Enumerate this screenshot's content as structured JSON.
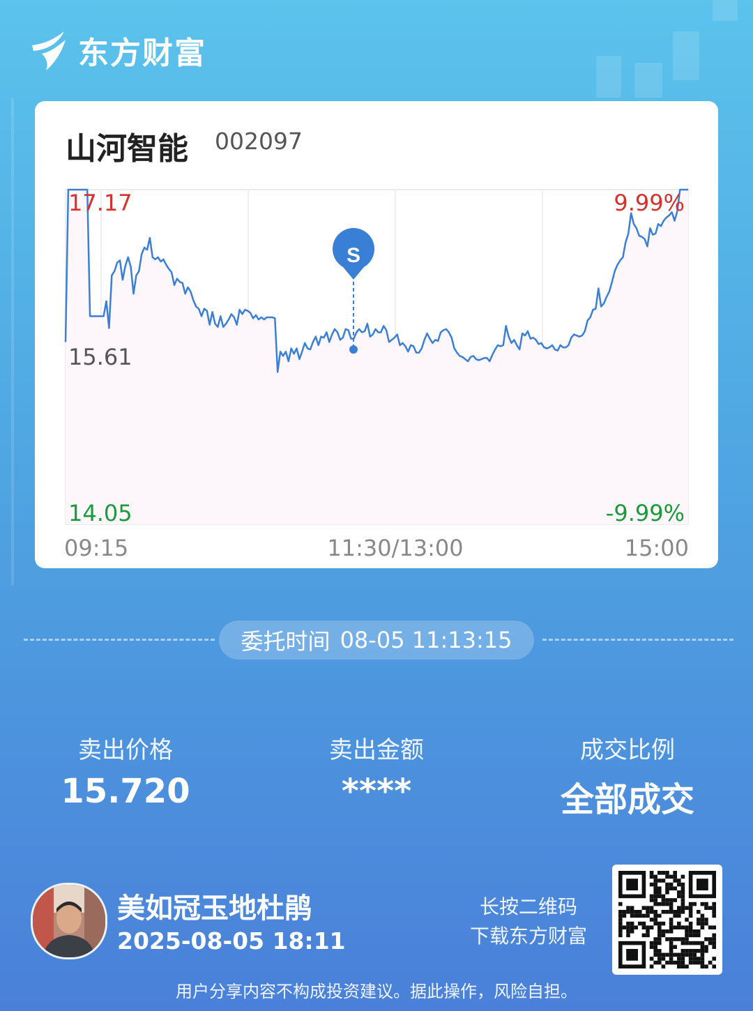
{
  "app": {
    "brand_name": "东方财富"
  },
  "stock": {
    "name": "山河智能",
    "code": "002097"
  },
  "chart_data": {
    "type": "line",
    "x_ticks": [
      "09:15",
      "11:30/13:00",
      "15:00"
    ],
    "y_left_labels": {
      "high": "17.17",
      "mid": "15.61",
      "low": "14.05"
    },
    "y_right_labels": {
      "high": "9.99%",
      "low": "-9.99%"
    },
    "ylim": [
      14.05,
      17.17
    ],
    "reference_price": 15.61,
    "trade_marker": {
      "label": "S",
      "price": 15.68
    },
    "series": [
      {
        "values": [
          15.75,
          17.17,
          17.17,
          17.17,
          17.17,
          17.17,
          17.17,
          17.17,
          17.17,
          15.99,
          15.99,
          15.99,
          15.99,
          15.99,
          15.99,
          16.13,
          15.88,
          16.37,
          16.41,
          16.49,
          16.51,
          16.33,
          16.46,
          16.54,
          16.45,
          16.2,
          16.37,
          16.41,
          16.57,
          16.63,
          16.61,
          16.72,
          16.54,
          16.52,
          16.54,
          16.5,
          16.52,
          16.47,
          16.43,
          16.4,
          16.28,
          16.34,
          16.31,
          16.3,
          16.2,
          16.26,
          16.22,
          16.14,
          16.08,
          16.06,
          15.99,
          16.06,
          16.04,
          15.91,
          16.03,
          15.92,
          15.89,
          15.99,
          15.89,
          15.92,
          15.96,
          16.01,
          15.98,
          15.91,
          16.05,
          16.01,
          16.05,
          16.04,
          16.02,
          15.97,
          16,
          15.96,
          15.98,
          15.96,
          15.98,
          15.98,
          15.98,
          15.97,
          15.47,
          15.66,
          15.62,
          15.66,
          15.57,
          15.69,
          15.64,
          15.69,
          15.59,
          15.66,
          15.74,
          15.69,
          15.68,
          15.75,
          15.8,
          15.72,
          15.8,
          15.79,
          15.84,
          15.75,
          15.82,
          15.87,
          15.84,
          15.77,
          15.79,
          15.87,
          15.86,
          15.78,
          15.78,
          15.84,
          15.87,
          15.84,
          15.85,
          15.92,
          15.8,
          15.82,
          15.87,
          15.84,
          15.84,
          15.9,
          15.86,
          15.75,
          15.77,
          15.79,
          15.82,
          15.72,
          15.74,
          15.71,
          15.66,
          15.72,
          15.71,
          15.65,
          15.65,
          15.69,
          15.77,
          15.83,
          15.78,
          15.74,
          15.77,
          15.76,
          15.84,
          15.86,
          15.87,
          15.84,
          15.79,
          15.69,
          15.65,
          15.62,
          15.61,
          15.59,
          15.57,
          15.61,
          15.62,
          15.59,
          15.58,
          15.59,
          15.6,
          15.6,
          15.57,
          15.63,
          15.68,
          15.72,
          15.71,
          15.72,
          15.9,
          15.8,
          15.74,
          15.77,
          15.72,
          15.68,
          15.83,
          15.81,
          15.85,
          15.78,
          15.79,
          15.77,
          15.73,
          15.74,
          15.7,
          15.69,
          15.7,
          15.72,
          15.68,
          15.67,
          15.72,
          15.7,
          15.7,
          15.72,
          15.79,
          15.82,
          15.81,
          15.8,
          15.81,
          15.85,
          15.95,
          15.98,
          16.05,
          16.06,
          16.25,
          16.08,
          16.11,
          16.17,
          16.22,
          16.31,
          16.41,
          16.47,
          16.51,
          16.54,
          16.68,
          16.76,
          16.95,
          16.85,
          16.81,
          16.74,
          16.73,
          16.71,
          16.64,
          16.81,
          16.75,
          16.76,
          16.85,
          16.83,
          16.88,
          16.91,
          16.93,
          16.96,
          16.88,
          16.97,
          17.17,
          17.17,
          17.17,
          17.17
        ]
      }
    ]
  },
  "order": {
    "time_label": "委托时间",
    "time_value": "08-05 11:13:15"
  },
  "stats": [
    {
      "label": "卖出价格",
      "value": "15.720"
    },
    {
      "label": "卖出金额",
      "value": "****"
    },
    {
      "label": "成交比例",
      "value": "全部成交"
    }
  ],
  "user": {
    "name": "美如冠玉地杜鹃",
    "share_time": "2025-08-05 18:11"
  },
  "qr_hint": {
    "line1": "长按二维码",
    "line2": "下载东方财富"
  },
  "disclaimer": "用户分享内容不构成投资建议。据此操作，风险自担。",
  "colors": {
    "line": "#3a7fd6",
    "up": "#e0302b",
    "down": "#1a9a3a",
    "marker": "#3a7fd6"
  }
}
